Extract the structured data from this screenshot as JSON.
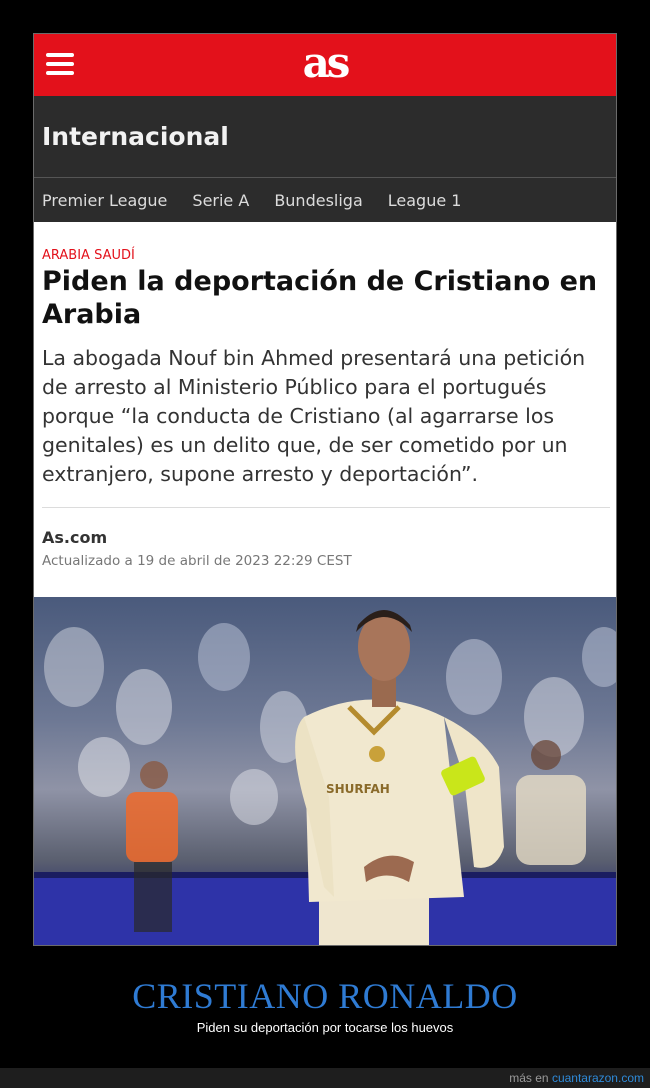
{
  "header": {
    "logo_text": "as"
  },
  "section": {
    "title": "Internacional"
  },
  "nav": {
    "items": [
      {
        "label": "Premier League"
      },
      {
        "label": "Serie A"
      },
      {
        "label": "Bundesliga"
      },
      {
        "label": "League 1"
      }
    ]
  },
  "article": {
    "kicker": "Arabia Saudí",
    "headline": "Piden la deportación de Cristiano en Arabia",
    "lede": "La abogada Nouf bin Ahmed presentará una petición de arresto al Ministerio Público para el portugués porque “la conducta de Cristiano (al agarrarse los genitales) es un delito que, de ser cometido por un extranjero, supone arresto y deportación”.",
    "byline": "As.com",
    "updated": "Actualizado a 19 de abril de 2023 22:29 CEST"
  },
  "photo": {
    "shirt_text": "SHURFAH"
  },
  "caption": {
    "title": "CRISTIANO RONALDO",
    "subtitle": "Piden su deportación por tocarse los huevos"
  },
  "footer": {
    "prefix": "más en",
    "link": "cuantarazon.com"
  },
  "colors": {
    "brand_red": "#e3111b",
    "dark_bar": "#2c2c2c",
    "caption_blue": "#2f7bd3"
  },
  "icons": {
    "menu": "hamburger-menu-icon"
  }
}
